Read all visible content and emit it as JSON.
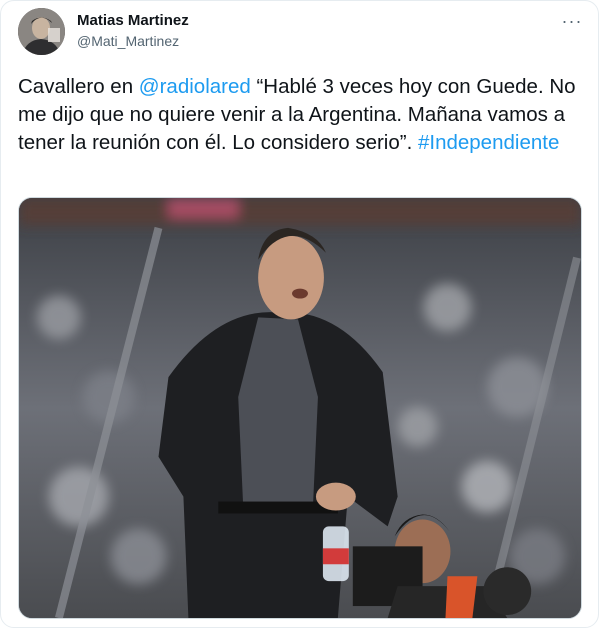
{
  "author": {
    "display_name": "Matias Martinez",
    "handle": "@Mati_Martinez"
  },
  "menu": {
    "more_label": "···",
    "icon": "more-horizontal-icon"
  },
  "tweet": {
    "text_1": "Cavallero en ",
    "mention": "@radiolared",
    "text_2": " “Hablé 3 veces hoy con Guede. No me dijo que no quiere venir a la Argentina. Mañana vamos a tener la reunión con él. Lo considero serio”. ",
    "hashtag": "#Independiente"
  },
  "colors": {
    "link": "#1d9bf0",
    "text": "#0f1419",
    "secondary": "#536471"
  }
}
